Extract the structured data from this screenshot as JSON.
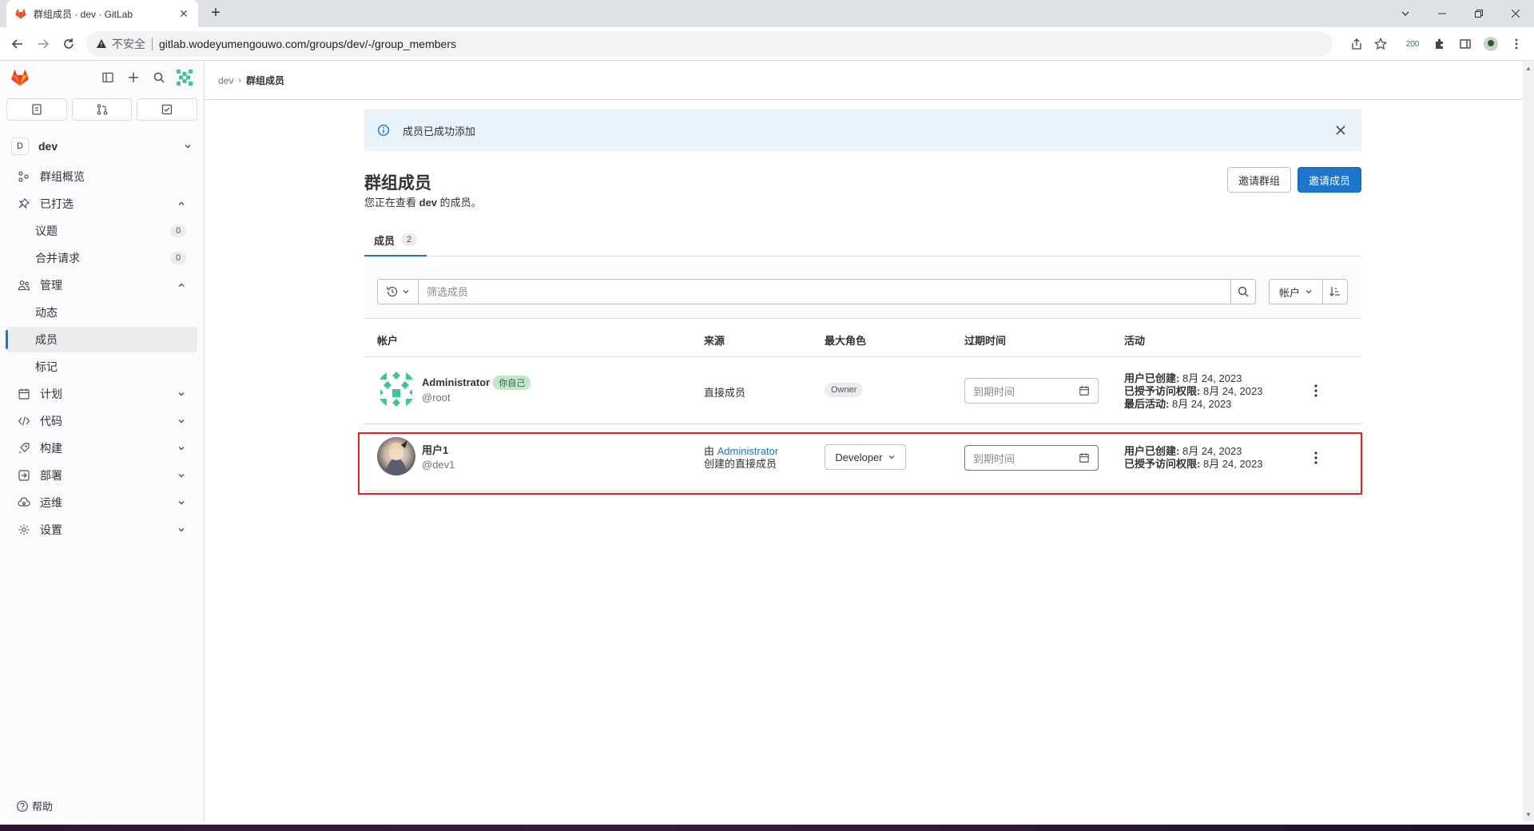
{
  "browser": {
    "tab_title": "群组成员 · dev · GitLab",
    "insecure_label": "不安全",
    "url": "gitlab.wodeyumengouwo.com/groups/dev/-/group_members",
    "ext_badge": "200"
  },
  "sidebar": {
    "context_initial": "D",
    "context_name": "dev",
    "overview": "群组概览",
    "pinned": "已打选",
    "pinned_items": [
      {
        "label": "议题",
        "count": "0"
      },
      {
        "label": "合并请求",
        "count": "0"
      }
    ],
    "manage": "管理",
    "manage_items": [
      "动态",
      "成员",
      "标记"
    ],
    "sections": [
      "计划",
      "代码",
      "构建",
      "部署",
      "运维",
      "设置"
    ],
    "help": "帮助"
  },
  "breadcrumb": {
    "parent": "dev",
    "current": "群组成员"
  },
  "alert": {
    "message": "成员已成功添加"
  },
  "page": {
    "title": "群组成员",
    "subtitle_prefix": "您正在查看",
    "subtitle_group": "dev",
    "subtitle_suffix": "的成员。",
    "invite_group": "邀请群组",
    "invite_member": "邀请成员"
  },
  "tabs": {
    "members_label": "成员",
    "members_count": "2"
  },
  "filter": {
    "placeholder": "筛选成员",
    "sort_label": "帐户"
  },
  "table": {
    "headers": {
      "account": "帐户",
      "source": "来源",
      "role": "最大角色",
      "expires": "过期时间",
      "activity": "活动"
    },
    "rows": [
      {
        "name": "Administrator",
        "you_badge": "你自己",
        "username": "@root",
        "source": "直接成员",
        "role": "Owner",
        "expires_placeholder": "到期时间",
        "activity": [
          {
            "label": "用户已创建:",
            "value": "8月 24, 2023"
          },
          {
            "label": "已授予访问权限:",
            "value": "8月 24, 2023"
          },
          {
            "label": "最后活动:",
            "value": "8月 24, 2023"
          }
        ]
      },
      {
        "name": "用户1",
        "username": "@dev1",
        "source_prefix": "由",
        "source_link": "Administrator",
        "source_suffix": "创建的直接成员",
        "role": "Developer",
        "expires_placeholder": "到期时间",
        "activity": [
          {
            "label": "用户已创建:",
            "value": "8月 24, 2023"
          },
          {
            "label": "已授予访问权限:",
            "value": "8月 24, 2023"
          }
        ]
      }
    ]
  },
  "colors": {
    "accent": "#1f75cb",
    "highlight": "#e0251f",
    "you_badge_bg": "#c3e6cd",
    "alert_bg": "#e9f3fc"
  }
}
